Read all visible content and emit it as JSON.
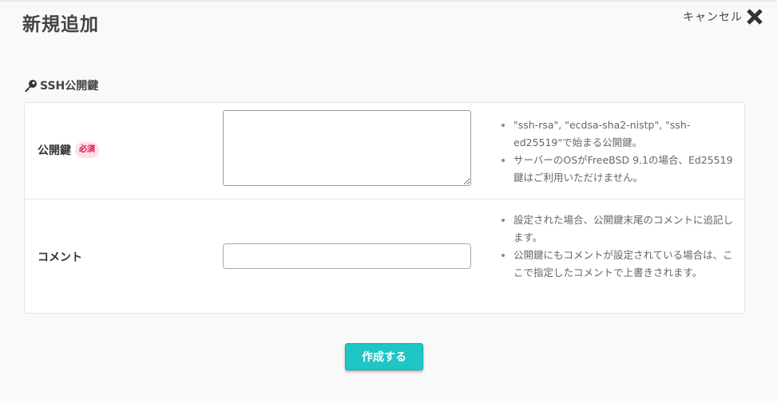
{
  "header": {
    "title": "新規追加",
    "cancel_label": "キャンセル",
    "close_icon": "close-icon"
  },
  "section": {
    "icon": "key-icon",
    "heading": "SSH公開鍵"
  },
  "form": {
    "public_key": {
      "label": "公開鍵",
      "required_badge": "必須",
      "value": "",
      "notes": [
        "\"ssh-rsa\", \"ecdsa-sha2-nistp\", \"ssh-ed25519\"で始まる公開鍵。",
        "サーバーのOSがFreeBSD 9.1の場合、Ed25519鍵はご利用いただけません。"
      ]
    },
    "comment": {
      "label": "コメント",
      "value": "",
      "notes": [
        "設定された場合、公開鍵末尾のコメントに追記します。",
        "公開鍵にもコメントが設定されている場合は、ここで指定したコメントで上書きされます。"
      ]
    }
  },
  "actions": {
    "create_label": "作成する"
  },
  "colors": {
    "accent": "#1ec6c5",
    "required_text": "#d6164a",
    "required_bg": "#fde0e6"
  }
}
